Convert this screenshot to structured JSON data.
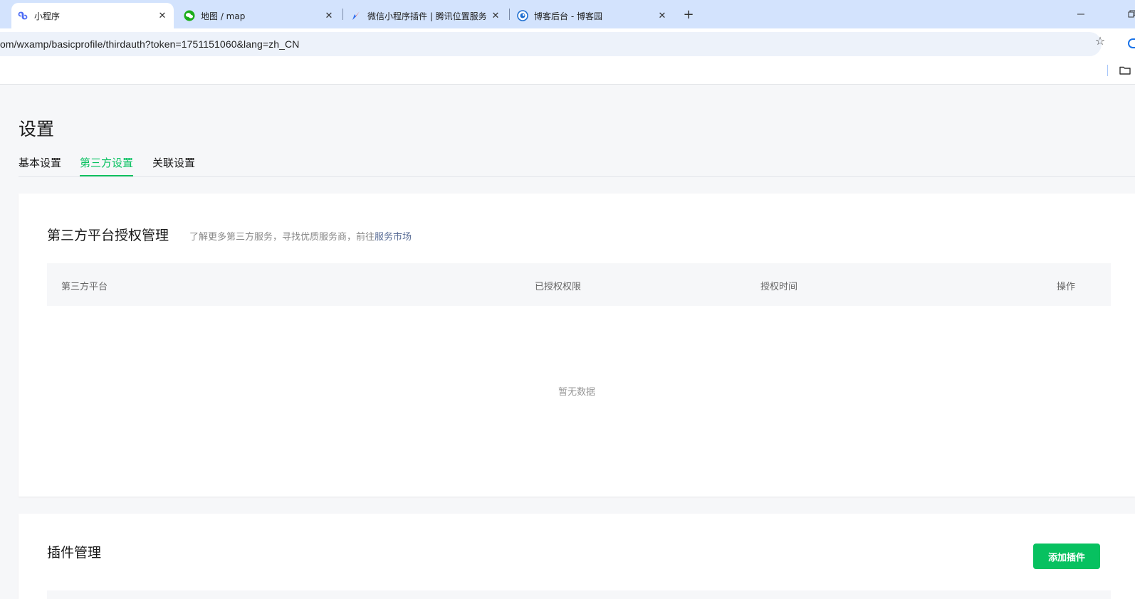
{
  "browser": {
    "tabs": [
      {
        "title": "小程序",
        "favicon": "mini-program-icon"
      },
      {
        "title": "地图 / map",
        "favicon": "wechat-icon"
      },
      {
        "title": "微信小程序插件 | 腾讯位置服务",
        "favicon": "tencent-location-icon"
      },
      {
        "title": "博客后台 - 博客园",
        "favicon": "cnblogs-icon"
      }
    ],
    "url": "om/wxamp/basicprofile/thirdauth?token=1751151060&lang=zh_CN"
  },
  "page": {
    "title": "设置",
    "tabs": [
      "基本设置",
      "第三方设置",
      "关联设置"
    ],
    "active_tab": "第三方设置"
  },
  "third_party": {
    "title": "第三方平台授权管理",
    "desc_prefix": "了解更多第三方服务，寻找优质服务商，前往",
    "desc_link": "服务市场",
    "columns": [
      "第三方平台",
      "已授权权限",
      "授权时间",
      "操作"
    ],
    "rows": [],
    "empty_text": "暂无数据"
  },
  "plugins": {
    "title": "插件管理",
    "add_button": "添加插件"
  },
  "colors": {
    "accent": "#07c160",
    "link": "#576b95",
    "tabbar": "#d3e3fd"
  }
}
